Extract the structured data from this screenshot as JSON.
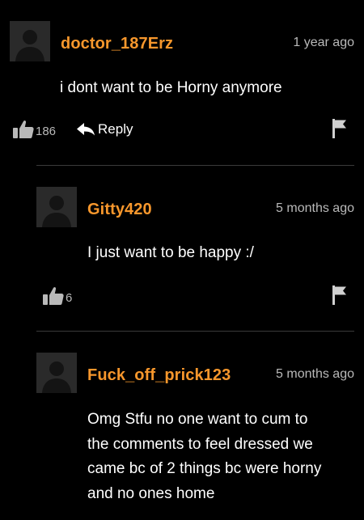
{
  "comments": [
    {
      "username": "doctor_187Erz",
      "timestamp": "1 year ago",
      "text": "i dont want to be Horny anymore",
      "likes": "186",
      "reply_label": "Reply"
    },
    {
      "username": "Gitty420",
      "timestamp": "5 months ago",
      "text": "I just want to be happy :/",
      "likes": "6"
    },
    {
      "username": "Fuck_off_prick123",
      "timestamp": "5 months ago",
      "text_lines": [
        "Omg Stfu no one want to cum to",
        "the comments to feel dressed we",
        "came bc of 2 things bc were horny",
        "and no ones home"
      ]
    }
  ],
  "icons": {
    "like": "thumbs-up-icon",
    "reply": "reply-arrow-icon",
    "flag": "flag-icon",
    "avatar": "default-user-avatar"
  },
  "colors": {
    "background": "#000000",
    "username": "#f7972c",
    "timestamp": "#b9b9b9",
    "text": "#ffffff",
    "divider": "#3a3a3a"
  }
}
